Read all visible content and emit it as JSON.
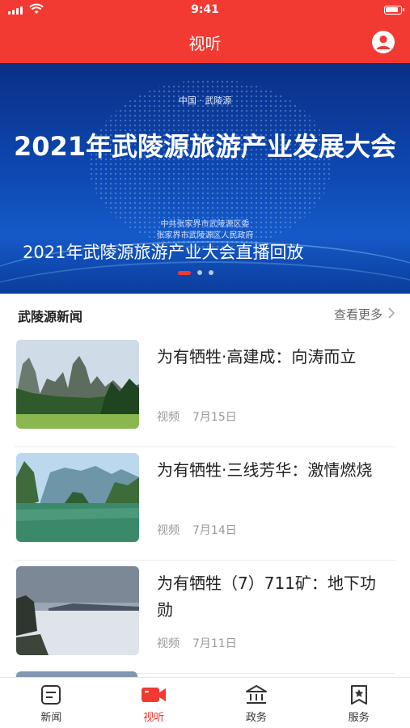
{
  "status_bar": {
    "time": "9:41"
  },
  "nav": {
    "title": "视听"
  },
  "banner": {
    "top_text": "中国 · 武陵源",
    "headline": "2021年武陵源旅游产业发展大会",
    "organizers": [
      "中共张家界市武陵源区委",
      "张家界市武陵源区人民政府"
    ],
    "caption": "2021年武陵源旅游产业大会直播回放",
    "pager": {
      "count": 3,
      "active_index": 0
    }
  },
  "section": {
    "title": "武陵源新闻",
    "more_label": "查看更多"
  },
  "news": [
    {
      "headline": "为有牺牲·高建成：向涛而立",
      "type": "视频",
      "date": "7月15日",
      "thumb": "karst-peaks-grass"
    },
    {
      "headline": "为有牺牲·三线芳华：激情燃烧",
      "type": "视频",
      "date": "7月14日",
      "thumb": "lake-cliffs"
    },
    {
      "headline": "为有牺牲（7）711矿：地下功勋",
      "type": "视频",
      "date": "7月11日",
      "thumb": "sea-of-clouds"
    }
  ],
  "tabs": [
    {
      "label": "新闻",
      "icon": "news-icon",
      "active": false
    },
    {
      "label": "视听",
      "icon": "video-camera-icon",
      "active": true
    },
    {
      "label": "政务",
      "icon": "government-building-icon",
      "active": false
    },
    {
      "label": "服务",
      "icon": "star-bookmark-icon",
      "active": false
    }
  ],
  "colors": {
    "brand_red": "#f23a33",
    "banner_blue": "#0d47b0",
    "text": "#222222",
    "muted": "#999999"
  }
}
